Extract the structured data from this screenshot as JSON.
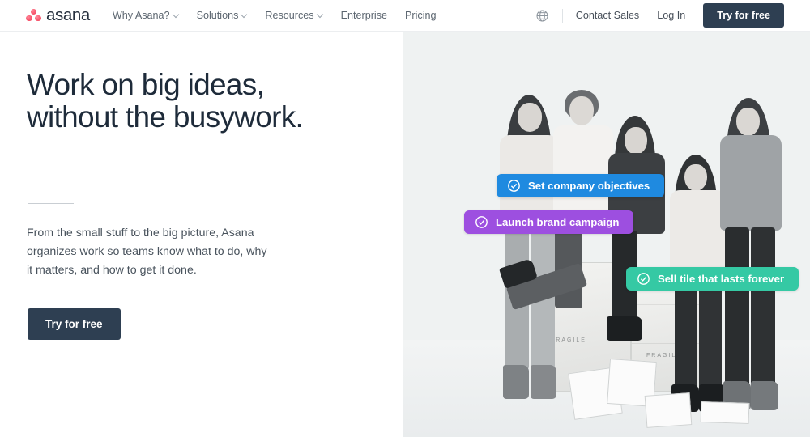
{
  "header": {
    "logo_text": "asana",
    "logo_icon": "asana-dots-logo",
    "nav": [
      {
        "label": "Why Asana?",
        "has_caret": true
      },
      {
        "label": "Solutions",
        "has_caret": true
      },
      {
        "label": "Resources",
        "has_caret": true
      },
      {
        "label": "Enterprise",
        "has_caret": false
      },
      {
        "label": "Pricing",
        "has_caret": false
      }
    ],
    "globe_icon": "globe-icon",
    "contact_sales": "Contact Sales",
    "log_in": "Log In",
    "try_free": "Try for free"
  },
  "hero": {
    "headline_line1": "Work on big ideas,",
    "headline_line2": "without the busywork.",
    "subcopy": "From the small stuff to the big picture, Asana organizes work so teams know what to do, why it matters, and how to get it done.",
    "cta": "Try for free"
  },
  "pills": [
    {
      "label": "Set company objectives",
      "color": "#1f8ae0",
      "icon": "check-circle-icon"
    },
    {
      "label": "Launch brand campaign",
      "color": "#9d4fe0",
      "icon": "check-circle-icon"
    },
    {
      "label": "Sell tile that lasts forever",
      "color": "#35c9a4",
      "icon": "check-circle-icon"
    }
  ],
  "colors": {
    "navy": "#2e3f52",
    "panel_bg": "#eff2f2",
    "logo_coral": "#f2485f",
    "text_dark": "#1e2b3a",
    "text_body": "#49535d",
    "nav_text": "#5c6670"
  },
  "photo": {
    "description": "Black and white photo of five people posed with wooden FRAGILE crates and patterned floor tiles",
    "crate_label": "FRAGILE"
  }
}
